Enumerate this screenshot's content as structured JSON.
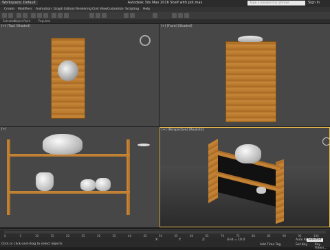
{
  "window": {
    "title": "Autodesk 3ds Max 2016    Shelf with pot.max",
    "workspace": "Workspace: Default",
    "search_placeholder": "Type a keyword or phrase",
    "signin": "Sign In"
  },
  "menu": [
    "Create",
    "Modifiers",
    "Animation",
    "Graph Editors",
    "Rendering",
    "Civil View",
    "Customize",
    "Scripting",
    "Help"
  ],
  "subbar": [
    "Selection",
    "Object Paint",
    "Populate"
  ],
  "viewports": {
    "top_left_label": "[+] [Top] [Shaded]",
    "top_right_label": "[+] [Front] [Shaded]",
    "bottom_left_label": "[+]",
    "bottom_right_label": "[+] [Perspective] [Realistic]"
  },
  "timeline": {
    "ticks": [
      "0",
      "5",
      "10",
      "15",
      "20",
      "25",
      "30",
      "35",
      "40",
      "45",
      "50",
      "55",
      "60",
      "65",
      "70",
      "75",
      "80",
      "85",
      "90",
      "95",
      "100"
    ]
  },
  "status": {
    "prompt": "Click or click-and-drag to select objects",
    "x_label": "X:",
    "y_label": "Y:",
    "z_label": "Z:",
    "x_value": "",
    "y_value": "",
    "z_value": "",
    "grid": "Grid = 10.0",
    "addtime": "Add Time Tag",
    "autokey": "Auto Key",
    "setkey": "Set Key",
    "selected": "Selected",
    "keyfilters": "Key Filters..."
  },
  "colors": {
    "accent_active_border": "#f2c14e",
    "wood": "#c07f33",
    "viewport_bg": "#474747"
  }
}
